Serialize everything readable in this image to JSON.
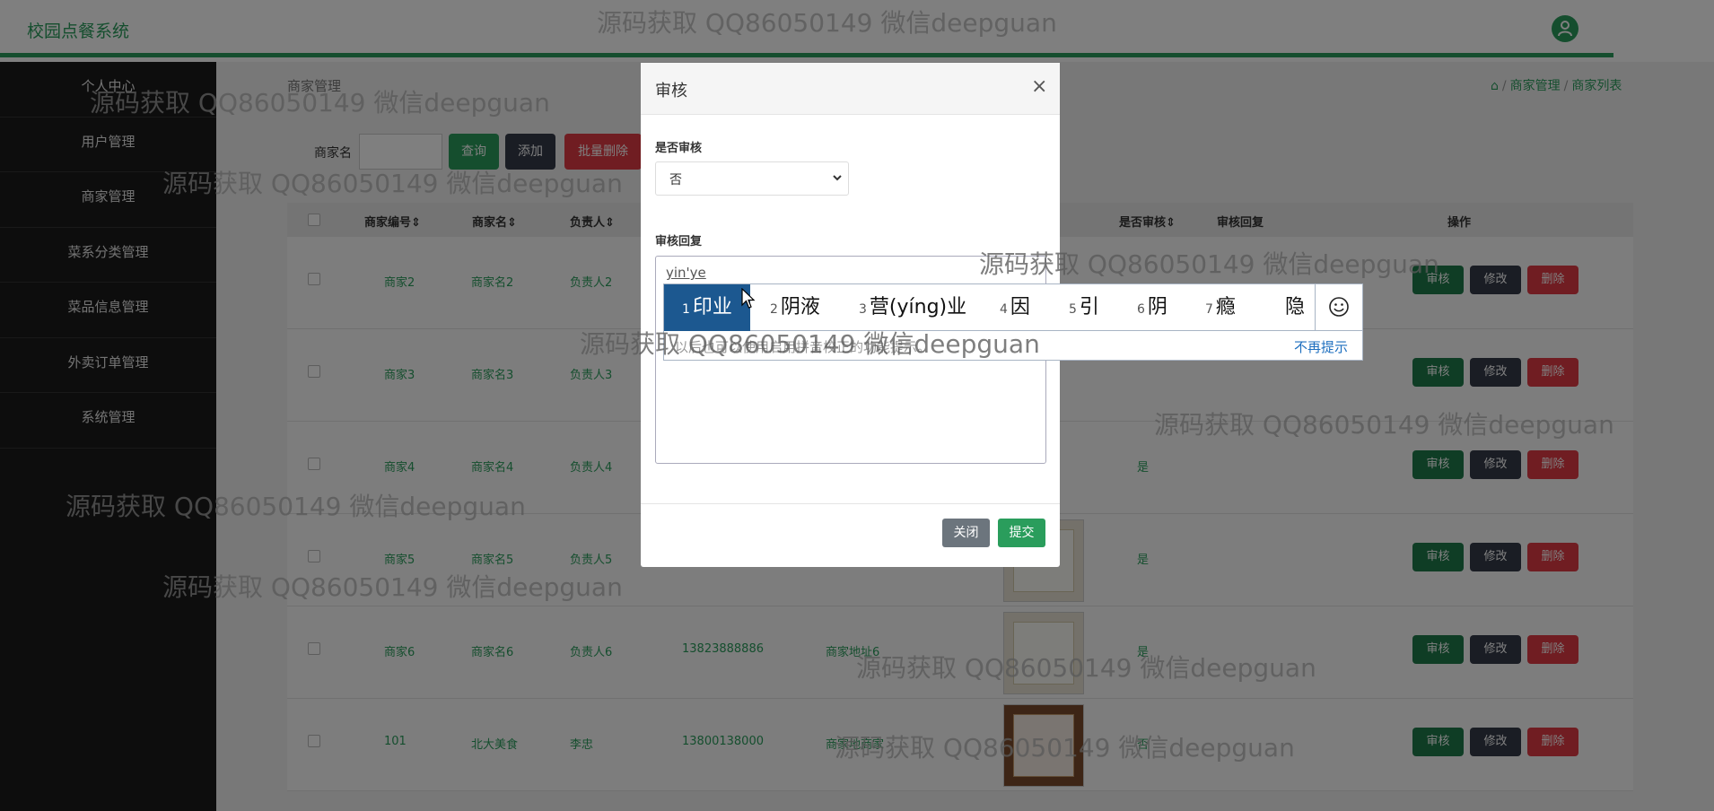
{
  "app": {
    "title": "校园点餐系统"
  },
  "sidebar": {
    "items": [
      {
        "label": "个人中心"
      },
      {
        "label": "用户管理"
      },
      {
        "label": "商家管理"
      },
      {
        "label": "菜系分类管理"
      },
      {
        "label": "菜品信息管理"
      },
      {
        "label": "外卖订单管理"
      },
      {
        "label": "系统管理"
      }
    ]
  },
  "page": {
    "title": "商家管理",
    "breadcrumb": [
      "商家管理",
      "商家列表"
    ]
  },
  "search": {
    "label": "商家名",
    "value": "",
    "query_label": "查询",
    "add_label": "添加",
    "batch_delete_label": "批量删除"
  },
  "table": {
    "headers": {
      "code": "商家编号",
      "name": "商家名",
      "owner": "负责人",
      "reviewed": "是否审核",
      "review_reply": "审核回复",
      "actions": "操作"
    },
    "rows": [
      {
        "code": "商家2",
        "name": "商家名2",
        "owner": "负责人2",
        "phone": "",
        "address": "",
        "reviewed": "",
        "thumb": false,
        "frame": false
      },
      {
        "code": "商家3",
        "name": "商家名3",
        "owner": "负责人3",
        "phone": "",
        "address": "",
        "reviewed": "",
        "thumb": false,
        "frame": false
      },
      {
        "code": "商家4",
        "name": "商家名4",
        "owner": "负责人4",
        "phone": "",
        "address": "",
        "reviewed": "是",
        "thumb": false,
        "frame": false
      },
      {
        "code": "商家5",
        "name": "商家名5",
        "owner": "负责人5",
        "phone": "",
        "address": "",
        "reviewed": "是",
        "thumb": true,
        "frame": false
      },
      {
        "code": "商家6",
        "name": "商家名6",
        "owner": "负责人6",
        "phone": "13823888886",
        "address": "商家地址6",
        "reviewed": "是",
        "thumb": true,
        "frame": false
      },
      {
        "code": "101",
        "name": "北大美食",
        "owner": "李忠",
        "phone": "13800138000",
        "address": "商家地商家",
        "reviewed": "否",
        "thumb": true,
        "frame": true
      }
    ],
    "row_actions": {
      "review": "审核",
      "edit": "修改",
      "delete": "删除"
    }
  },
  "modal": {
    "title": "审核",
    "close_symbol": "×",
    "approve_label": "是否审核",
    "approve_value": "否",
    "reply_label": "审核回复",
    "reply_value": "yin'ye",
    "cancel_label": "关闭",
    "submit_label": "提交"
  },
  "ime": {
    "candidates": [
      {
        "num": "1",
        "text": "印业"
      },
      {
        "num": "2",
        "text": "阴液"
      },
      {
        "num": "3",
        "text": "营(yíng)业"
      },
      {
        "num": "4",
        "text": "因"
      },
      {
        "num": "5",
        "text": "引"
      },
      {
        "num": "6",
        "text": "阴"
      },
      {
        "num": "7",
        "text": "瘾"
      },
      {
        "num": "",
        "text": "隐"
      }
    ],
    "tip": "以后也可以使用启用拼音校正的功能提示。",
    "dismiss": "不再提示"
  },
  "watermark": "源码获取 QQ86050149 微信deepguan",
  "colors": {
    "accent": "#2a9d5c",
    "danger": "#e03b44",
    "dark": "#343a48",
    "ime_active": "#1c5890"
  }
}
